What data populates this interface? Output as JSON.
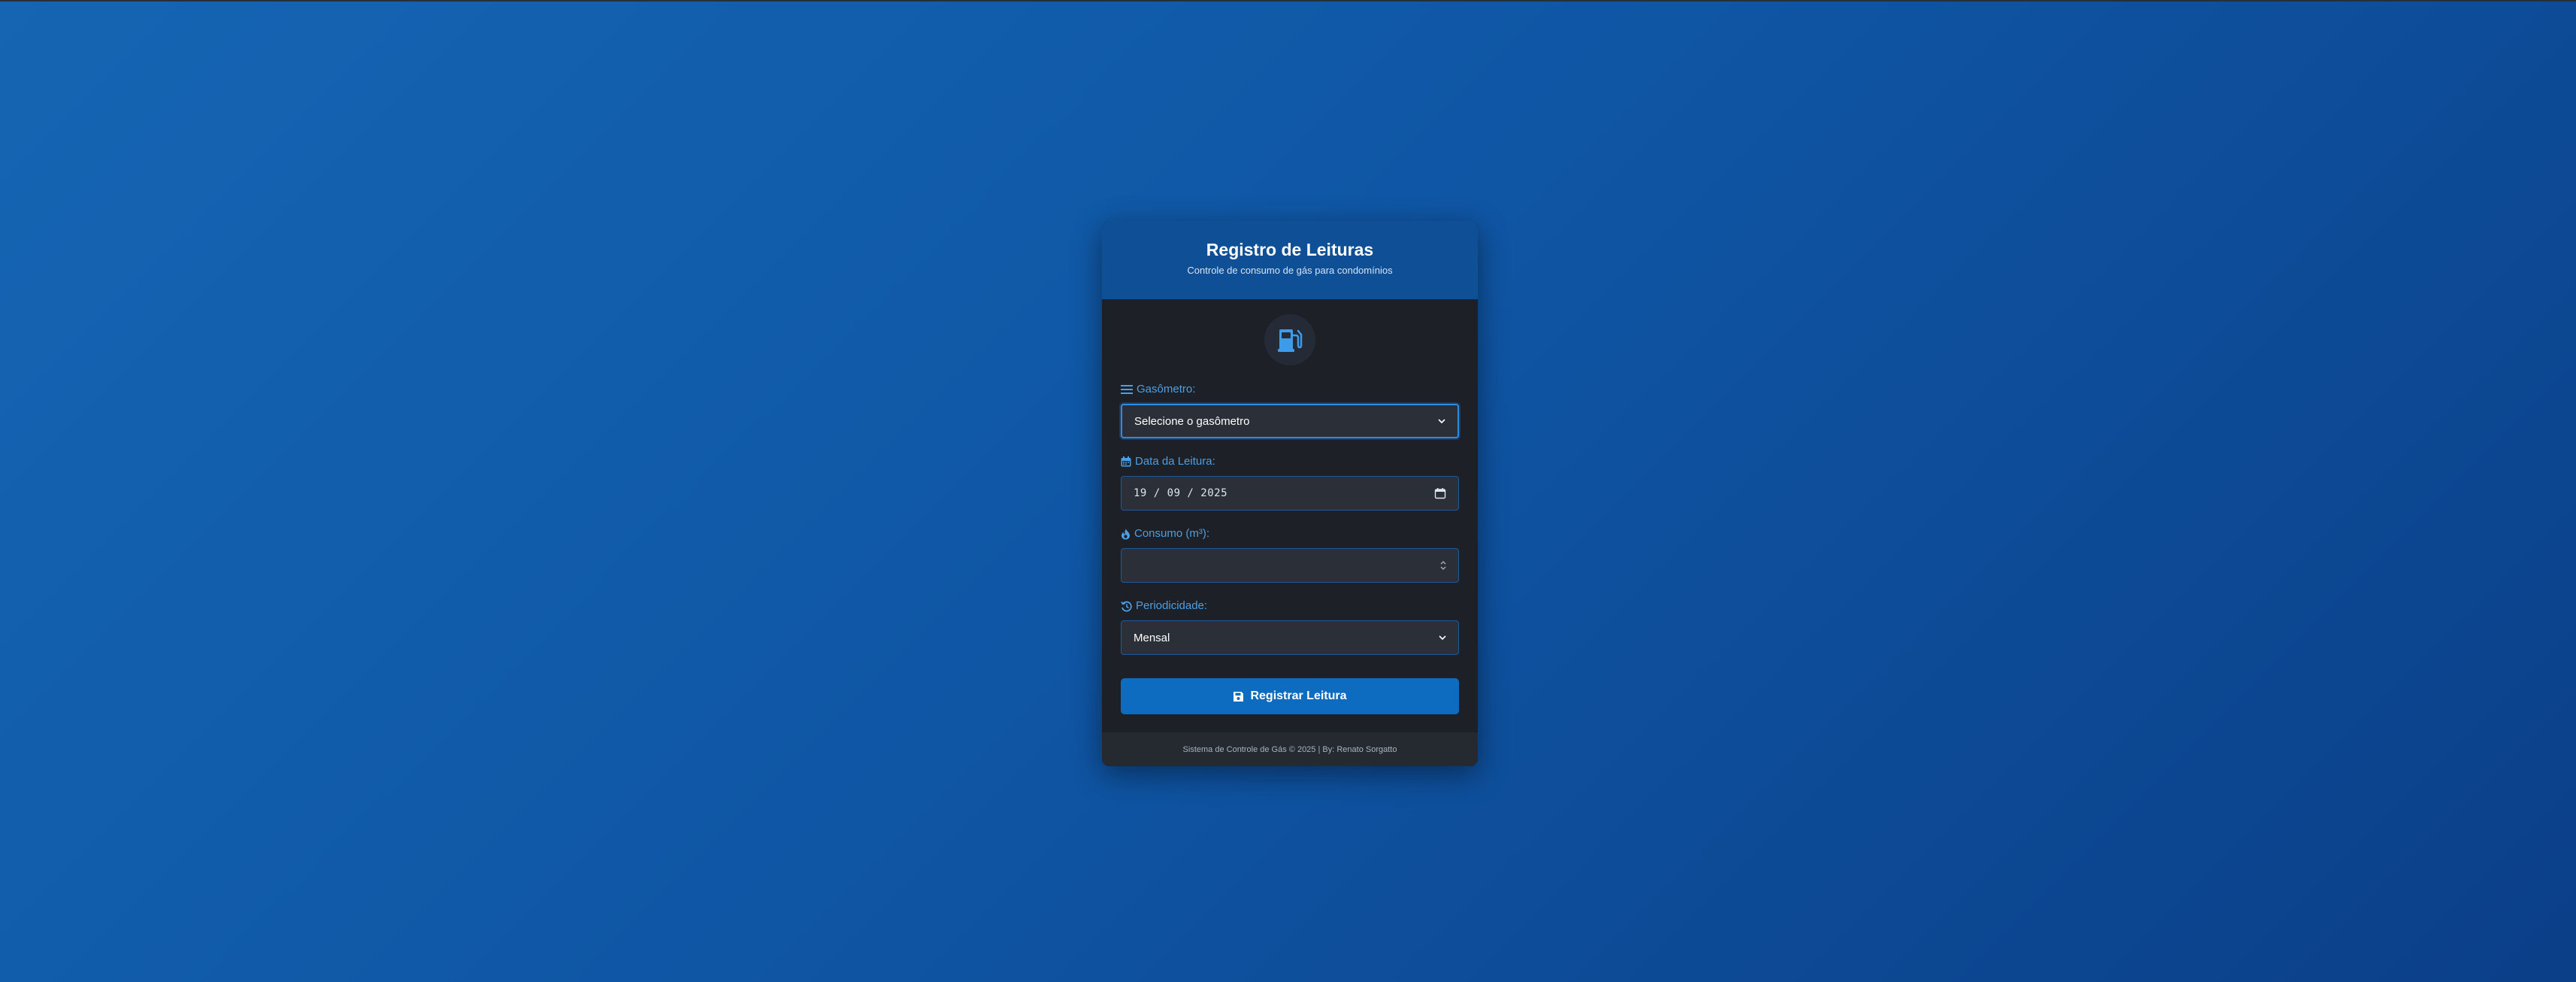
{
  "header": {
    "title": "Registro de Leituras",
    "subtitle": "Controle de consumo de gás para condomínios"
  },
  "icons": {
    "main": "gas-pump-icon",
    "meter": "list-icon",
    "date": "calendar-icon",
    "consumption": "fire-icon",
    "period": "history-icon",
    "submit": "save-icon"
  },
  "form": {
    "meter": {
      "label": "Gasômetro:",
      "selected": "Selecione o gasômetro"
    },
    "date": {
      "label": "Data da Leitura:",
      "value": "19 / 09 / 2025"
    },
    "consumption": {
      "label": "Consumo (m³):",
      "value": ""
    },
    "period": {
      "label": "Periodicidade:",
      "selected": "Mensal"
    },
    "submit_label": "Registrar Leitura"
  },
  "footer": {
    "text": "Sistema de Controle de Gás © 2025 | By: Renato Sorgatto"
  },
  "colors": {
    "accent": "#4a9fe6",
    "header_bg": "#0f4f95",
    "button_bg": "#0e6cc0",
    "card_bg": "#1d2127"
  }
}
